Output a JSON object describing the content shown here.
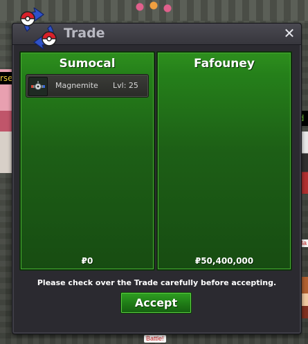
{
  "dialog": {
    "title": "Trade",
    "close_icon": "close-icon",
    "logo_icon": "trade-swap-icon"
  },
  "left_panel": {
    "player": "Sumocal",
    "items": [
      {
        "name": "Magnemite",
        "level": "Lvl: 25",
        "icon": "magnemite-sprite-icon"
      }
    ],
    "money": "₽0"
  },
  "right_panel": {
    "player": "Fafouney",
    "items": [],
    "money": "₽50,400,000"
  },
  "footer": {
    "notice": "Please check over the Trade carefully before accepting.",
    "accept_label": "Accept"
  },
  "background": {
    "battle_tag": "Battle!",
    "left_tag": "rse",
    "right_tag": "rd"
  },
  "colors": {
    "panel_green": "#25801a",
    "accept_green": "#1f7a16",
    "dialog_bg": "#2b2a30",
    "title_text": "#b9b9c2"
  }
}
